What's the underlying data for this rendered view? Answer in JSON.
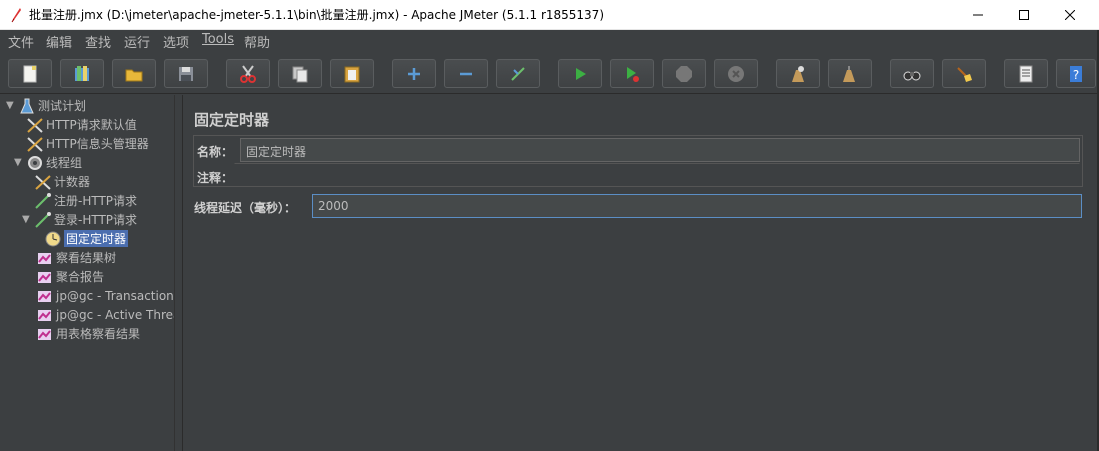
{
  "window": {
    "title": "批量注册.jmx (D:\\jmeter\\apache-jmeter-5.1.1\\bin\\批量注册.jmx) - Apache JMeter (5.1.1 r1855137)",
    "app_icon": "jmeter-feather-icon",
    "controls": {
      "minimize": "—",
      "maximize": "☐",
      "close": "✕"
    }
  },
  "menu": [
    "文件",
    "编辑",
    "查找",
    "运行",
    "选项",
    "Tools",
    "帮助"
  ],
  "toolbar": [
    "new-icon",
    "templates-icon",
    "open-icon",
    "save-icon",
    "cut-icon",
    "copy-icon",
    "paste-icon",
    "expand-icon",
    "collapse-icon",
    "toggle-icon",
    "start-icon",
    "start-no-pause-icon",
    "stop-icon",
    "shutdown-icon",
    "clear-icon",
    "clear-all-icon",
    "search-icon",
    "reset-search-icon",
    "function-helper-icon",
    "help-icon"
  ],
  "tree": {
    "nodes": [
      {
        "label": "测试计划",
        "icon": "test-plan-icon",
        "expanded": true
      },
      {
        "label": "HTTP请求默认值",
        "icon": "config-icon"
      },
      {
        "label": "HTTP信息头管理器",
        "icon": "config-icon"
      },
      {
        "label": "线程组",
        "icon": "thread-group-icon",
        "expanded": true
      },
      {
        "label": "计数器",
        "icon": "config-icon"
      },
      {
        "label": "注册-HTTP请求",
        "icon": "sampler-icon"
      },
      {
        "label": "登录-HTTP请求",
        "icon": "sampler-icon",
        "expanded": true
      },
      {
        "label": "固定定时器",
        "icon": "timer-icon",
        "selected": true
      },
      {
        "label": "察看结果树",
        "icon": "listener-icon"
      },
      {
        "label": "聚合报告",
        "icon": "listener-icon"
      },
      {
        "label": "jp@gc - Transactions",
        "icon": "listener-icon"
      },
      {
        "label": "jp@gc - Active Threac",
        "icon": "listener-icon"
      },
      {
        "label": "用表格察看结果",
        "icon": "listener-icon"
      }
    ]
  },
  "panel": {
    "title": "固定定时器",
    "name_label": "名称：",
    "name_value": "固定定时器",
    "comment_label": "注释：",
    "comment_value": "",
    "delay_label": "线程延迟（毫秒）：",
    "delay_value": "2000"
  },
  "colors": {
    "background": "#3c3f41",
    "selection": "#4b6eaf",
    "text": "#bbbbbb",
    "focus_border": "#5b8ec5"
  }
}
